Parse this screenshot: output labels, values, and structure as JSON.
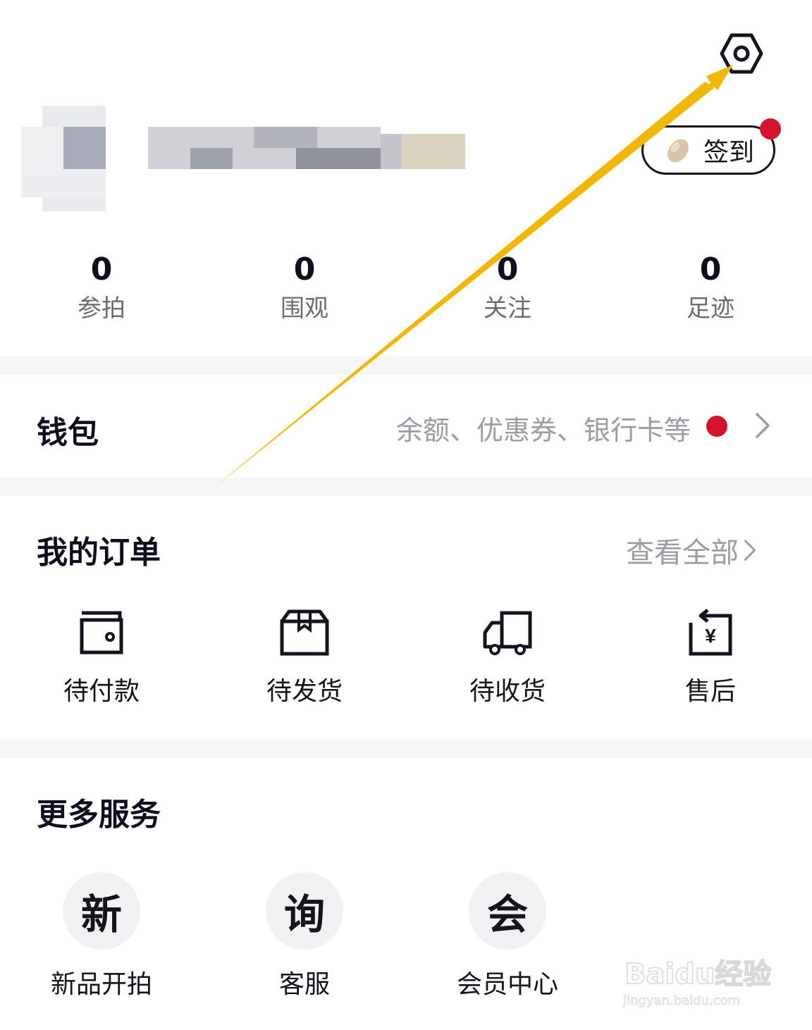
{
  "header": {
    "settings_icon": "hexagon-gear-icon",
    "checkin_label": "签到",
    "checkin_icon": "bean-icon",
    "checkin_badge_color": "#d4142c"
  },
  "stats": [
    {
      "value": "0",
      "label": "参拍"
    },
    {
      "value": "0",
      "label": "围观"
    },
    {
      "value": "0",
      "label": "关注"
    },
    {
      "value": "0",
      "label": "足迹"
    }
  ],
  "wallet": {
    "title": "钱包",
    "subtitle": "余额、优惠券、银行卡等",
    "badge_color": "#d4142c"
  },
  "orders": {
    "title": "我的订单",
    "view_all": "查看全部",
    "items": [
      {
        "label": "待付款",
        "icon": "wallet-icon"
      },
      {
        "label": "待发货",
        "icon": "package-icon"
      },
      {
        "label": "待收货",
        "icon": "truck-icon"
      },
      {
        "label": "售后",
        "icon": "refund-icon"
      }
    ]
  },
  "services": {
    "title": "更多服务",
    "items": [
      {
        "glyph": "新",
        "label": "新品开拍"
      },
      {
        "glyph": "询",
        "label": "客服"
      },
      {
        "glyph": "会",
        "label": "会员中心"
      }
    ]
  },
  "annotation": {
    "arrow_color": "#f2b705"
  },
  "watermark": {
    "brand": "Baidu经验",
    "url": "jingyan.baidu.com"
  }
}
